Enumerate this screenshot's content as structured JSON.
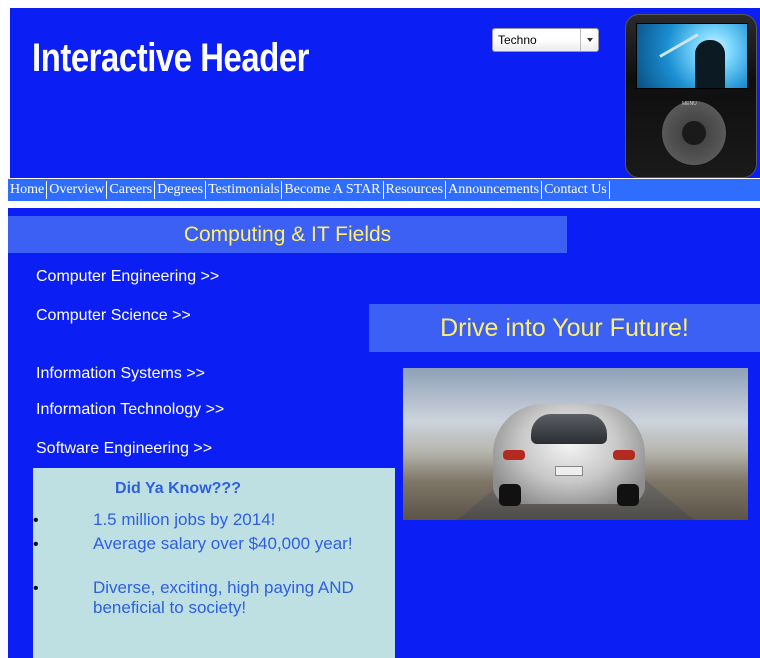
{
  "header": {
    "title": "Interactive Header",
    "genre_select": {
      "selected": "Techno"
    },
    "player_menu_label": "MENU"
  },
  "nav": {
    "items": [
      "Home",
      "Overview",
      "Careers",
      "Degrees",
      "Testimonials",
      "Become A STAR",
      "Resources",
      "Announcements",
      "Contact Us"
    ]
  },
  "main": {
    "section_heading": "Computing & IT Fields",
    "links": [
      "Computer Engineering >>",
      "Computer Science >>",
      "Information Systems >>",
      "Information Technology >>",
      "Software Engineering >>"
    ],
    "promo_title": "Drive into Your Future!",
    "facts": {
      "title": "Did Ya Know???",
      "items": [
        "1.5 million jobs by 2014!",
        "Average salary over $40,000 year!",
        "Diverse, exciting, high paying AND beneficial to society!"
      ]
    }
  },
  "colors": {
    "background_blue": "#0b1ff5",
    "bar_blue": "#3b60f3",
    "nav_blue": "#2f6dff",
    "heading_yellow": "#ffef6e",
    "fact_box": "#bfe0e2",
    "fact_text": "#2d5fe0"
  },
  "icons": {
    "select_arrow": "chevron-down-icon",
    "player": "music-player-icon"
  }
}
